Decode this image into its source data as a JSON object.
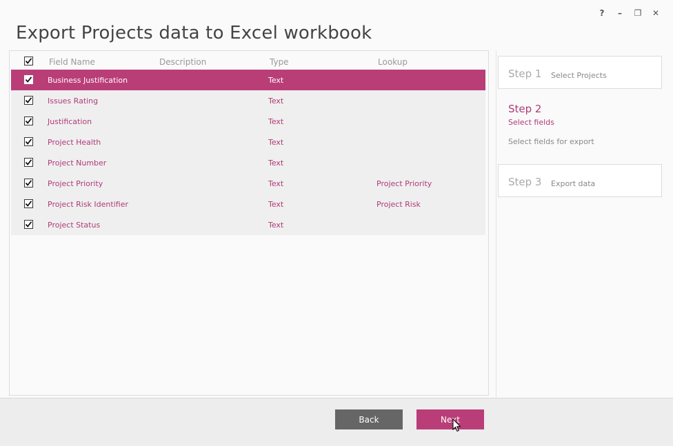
{
  "window": {
    "title": "Export Projects data to Excel workbook",
    "controls": {
      "help": "?",
      "minimize": "–",
      "restore": "❐",
      "close": "✕"
    }
  },
  "grid": {
    "columns": [
      "Field Name",
      "Description",
      "Type",
      "Lookup"
    ],
    "header_checked": true,
    "rows": [
      {
        "checked": true,
        "field": "Business Justification",
        "description": "",
        "type": "Text",
        "lookup": "",
        "selected": true
      },
      {
        "checked": true,
        "field": "Issues Rating",
        "description": "",
        "type": "Text",
        "lookup": ""
      },
      {
        "checked": true,
        "field": "Justification",
        "description": "",
        "type": "Text",
        "lookup": ""
      },
      {
        "checked": true,
        "field": "Project Health",
        "description": "",
        "type": "Text",
        "lookup": ""
      },
      {
        "checked": true,
        "field": "Project Number",
        "description": "",
        "type": "Text",
        "lookup": ""
      },
      {
        "checked": true,
        "field": "Project Priority",
        "description": "",
        "type": "Text",
        "lookup": "Project Priority"
      },
      {
        "checked": true,
        "field": "Project Risk Identifier",
        "description": "",
        "type": "Text",
        "lookup": "Project Risk"
      },
      {
        "checked": true,
        "field": "Project Status",
        "description": "",
        "type": "Text",
        "lookup": ""
      }
    ]
  },
  "steps": {
    "step1": {
      "num": "Step 1",
      "label": "Select Projects"
    },
    "step2": {
      "num": "Step 2",
      "label": "Select fields",
      "desc": "Select fields for export"
    },
    "step3": {
      "num": "Step 3",
      "label": "Export data"
    }
  },
  "footer": {
    "back_label": "Back",
    "next_label": "Next"
  },
  "colors": {
    "accent": "#b93e78",
    "accent_text": "#b03a77",
    "back_button": "#666666"
  }
}
